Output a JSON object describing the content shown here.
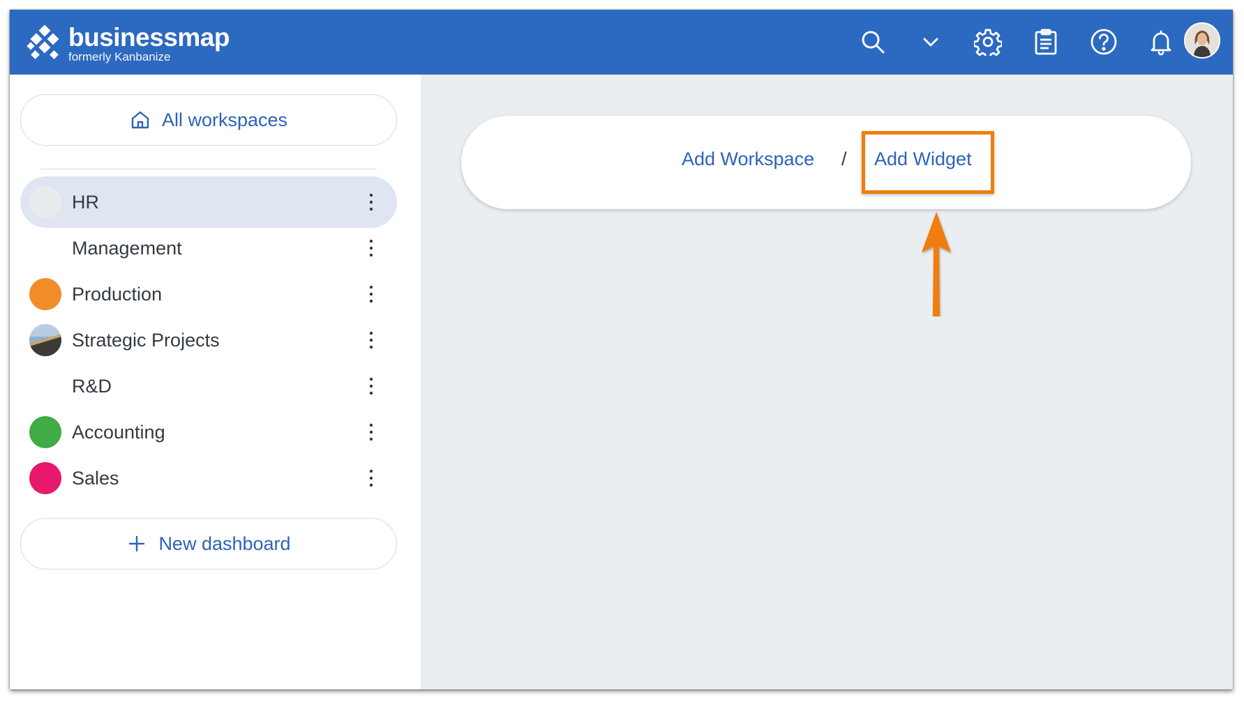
{
  "header": {
    "brand": "businessmap",
    "brand_sub": "formerly Kanbanize",
    "icons": [
      "search-icon",
      "chevron-down-icon",
      "gear-icon",
      "clipboard-icon",
      "help-icon",
      "bell-icon"
    ],
    "color": "#2c69c0"
  },
  "sidebar": {
    "all_workspaces": "All workspaces",
    "workspaces": [
      {
        "label": "HR",
        "color": "#e9ecef",
        "active": true
      },
      {
        "label": "Management",
        "color": "",
        "active": false
      },
      {
        "label": "Production",
        "color": "#f28c28",
        "active": false
      },
      {
        "label": "Strategic Projects",
        "color": "image",
        "active": false
      },
      {
        "label": "R&D",
        "color": "",
        "active": false
      },
      {
        "label": "Accounting",
        "color": "#3fac46",
        "active": false
      },
      {
        "label": "Sales",
        "color": "#e8186d",
        "active": false
      }
    ],
    "new_dashboard": "New dashboard"
  },
  "main": {
    "breadcrumb": {
      "add_workspace": "Add Workspace",
      "separator": "/",
      "add_widget": "Add Widget"
    },
    "highlight_color": "#f07d0c"
  }
}
